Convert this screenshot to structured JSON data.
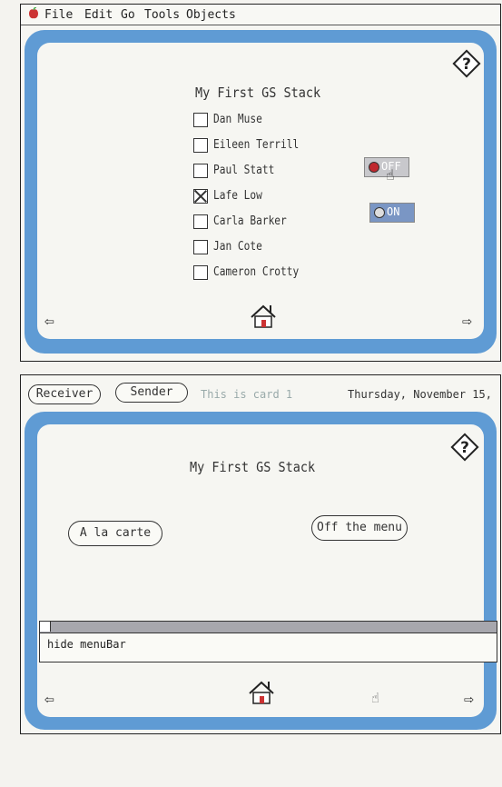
{
  "menubar": {
    "items": [
      "File",
      "Edit",
      "Go",
      "Tools",
      "Objects"
    ]
  },
  "card1": {
    "title": "My First GS Stack",
    "names": [
      {
        "label": "Dan Muse",
        "checked": false
      },
      {
        "label": "Eileen Terrill",
        "checked": false
      },
      {
        "label": "Paul Statt",
        "checked": false
      },
      {
        "label": "Lafe Low",
        "checked": true
      },
      {
        "label": "Carla Barker",
        "checked": false
      },
      {
        "label": "Jan Cote",
        "checked": false
      },
      {
        "label": "Cameron Crotty",
        "checked": false
      }
    ],
    "radio_off": "OFF",
    "radio_on": "ON"
  },
  "card2": {
    "receiver_label": "Receiver",
    "sender_label": "Sender",
    "card_status": "This is card 1",
    "date_text": "Thursday, November 15,",
    "title": "My First GS Stack",
    "alacarte_label": "A la carte",
    "offmenu_label": "Off the menu",
    "message_text": "hide menuBar"
  }
}
